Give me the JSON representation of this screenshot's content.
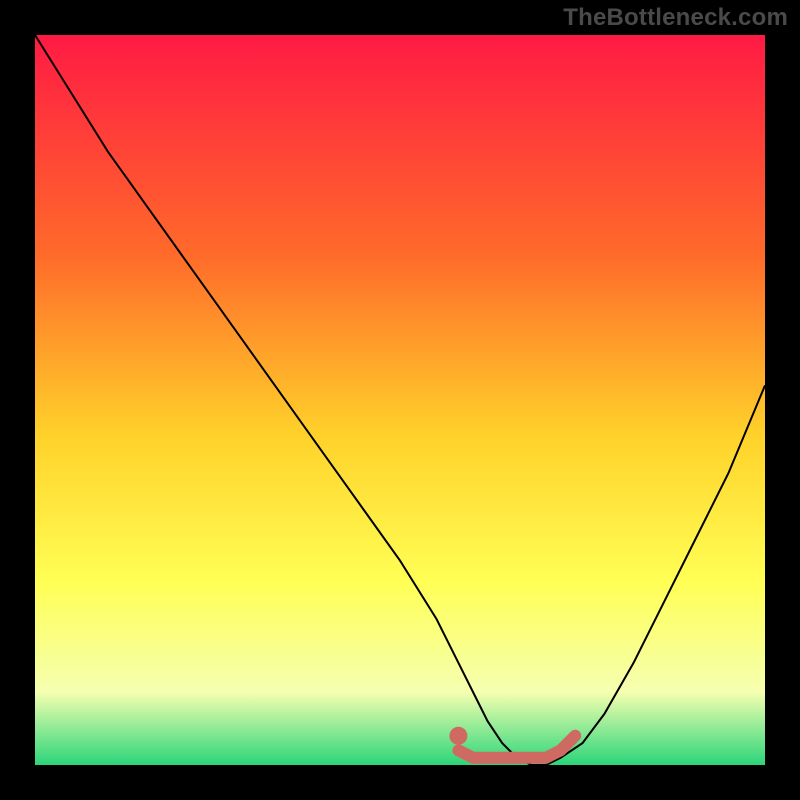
{
  "watermark": "TheBottleneck.com",
  "colors": {
    "black": "#000000",
    "watermark": "#4a4a4a",
    "curve": "#000000",
    "highlight": "#cf6a63",
    "grad_top": "#ff1a44",
    "grad_mid1": "#ff6a2a",
    "grad_mid2": "#ffd22a",
    "grad_mid3": "#ffff55",
    "grad_mid4": "#f5ffb0",
    "grad_bot": "#2bd57a"
  },
  "chart_data": {
    "type": "line",
    "title": "",
    "xlabel": "",
    "ylabel": "",
    "xlim": [
      0,
      100
    ],
    "ylim": [
      0,
      100
    ],
    "series": [
      {
        "name": "curve",
        "x": [
          0,
          5,
          10,
          15,
          20,
          25,
          30,
          35,
          40,
          45,
          50,
          55,
          58,
          60,
          62,
          64,
          66,
          68,
          70,
          72,
          75,
          78,
          82,
          86,
          90,
          95,
          100
        ],
        "values": [
          100,
          92,
          84,
          77,
          70,
          63,
          56,
          49,
          42,
          35,
          28,
          20,
          14,
          10,
          6,
          3,
          1,
          0,
          0,
          1,
          3,
          7,
          14,
          22,
          30,
          40,
          52
        ]
      }
    ],
    "highlight": {
      "x": [
        58,
        60,
        62,
        64,
        66,
        68,
        70,
        72,
        74
      ],
      "values": [
        2,
        1,
        1,
        1,
        1,
        1,
        1,
        2,
        4
      ]
    },
    "highlight_dot": {
      "x": 58,
      "y": 4
    }
  }
}
